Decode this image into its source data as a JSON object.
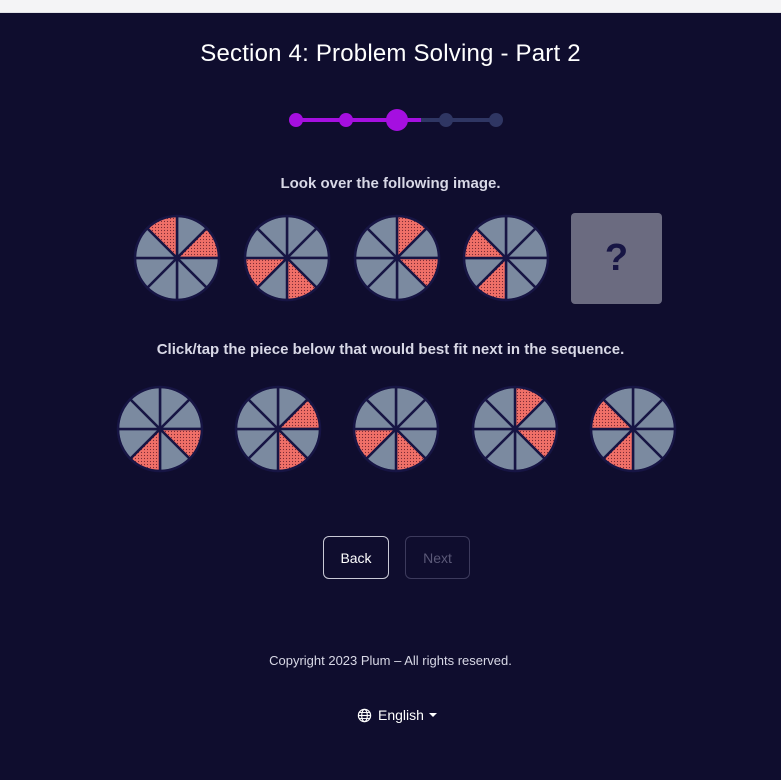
{
  "header": {
    "title": "Section 4: Problem Solving - Part 2"
  },
  "progress": {
    "total_steps": 5,
    "current_step": 3
  },
  "instructions": {
    "look": "Look over the following image.",
    "select": "Click/tap the piece below that would best fit next in the sequence."
  },
  "sequence": {
    "pies": [
      {
        "shaded": [
          7,
          1
        ]
      },
      {
        "shaded": [
          3,
          5
        ]
      },
      {
        "shaded": [
          0,
          2
        ]
      },
      {
        "shaded": [
          6,
          4
        ]
      }
    ],
    "missing_label": "?"
  },
  "options": [
    {
      "shaded": [
        2,
        4
      ]
    },
    {
      "shaded": [
        1,
        3
      ]
    },
    {
      "shaded": [
        5,
        3
      ]
    },
    {
      "shaded": [
        0,
        2
      ]
    },
    {
      "shaded": [
        6,
        4
      ]
    }
  ],
  "buttons": {
    "back": "Back",
    "next": "Next",
    "next_enabled": false
  },
  "footer": {
    "copyright": "Copyright 2023 Plum – All rights reserved."
  },
  "language": {
    "label": "English",
    "icon": "globe-icon"
  },
  "colors": {
    "background": "#0f0d2e",
    "accent": "#a50fe0",
    "inactive_step": "#2f3663",
    "slice": "#7b8aa0",
    "slice_shaded": "#f07068",
    "divider": "#171544"
  }
}
